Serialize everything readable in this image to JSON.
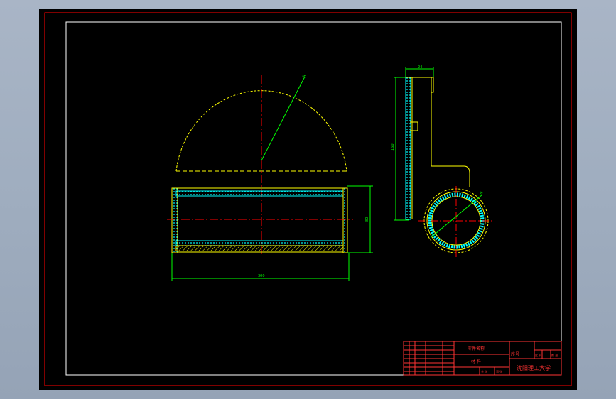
{
  "drawing": {
    "colors": {
      "background": "#000000",
      "sheet_border": "#ff0000",
      "outline": "#ffff00",
      "hatch": "#00ffff",
      "centerline": "#ff0000",
      "dimension": "#00ff00",
      "text": "#ff3333",
      "frame": "#ffffff"
    },
    "dimensions": {
      "front_radius": "R",
      "front_width": "300",
      "front_height": "80",
      "side_width": "24",
      "side_height": "160",
      "side_radius": "R"
    }
  },
  "title_block": {
    "part_name": "零件名称",
    "material": "材 料",
    "serial_label": "序号",
    "university": "沈阳理工大学",
    "scale_cells": [
      "",
      "比 例",
      "数 量"
    ],
    "sheet_cells": [
      "共 张",
      "第 张"
    ]
  }
}
